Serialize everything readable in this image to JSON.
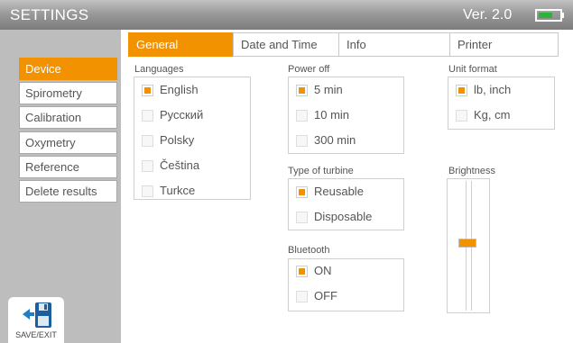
{
  "header": {
    "title": "SETTINGS",
    "version": "Ver. 2.0",
    "battery_level": 0.7,
    "battery_color": "#2bb33a"
  },
  "accent_color": "#f39200",
  "sidebar": {
    "items": [
      {
        "label": "Device",
        "active": true
      },
      {
        "label": "Spirometry",
        "active": false
      },
      {
        "label": "Calibration",
        "active": false
      },
      {
        "label": "Oxymetry",
        "active": false
      },
      {
        "label": "Reference",
        "active": false
      },
      {
        "label": "Delete results",
        "active": false
      }
    ]
  },
  "save_button": {
    "label": "SAVE/EXIT",
    "icon": "save-exit-icon"
  },
  "tabs": [
    {
      "label": "General",
      "active": true
    },
    {
      "label": "Date and Time",
      "active": false
    },
    {
      "label": "Info",
      "active": false
    },
    {
      "label": "Printer",
      "active": false
    }
  ],
  "languages": {
    "label": "Languages",
    "options": [
      {
        "label": "English",
        "checked": true
      },
      {
        "label": "Русский",
        "checked": false
      },
      {
        "label": "Polsky",
        "checked": false
      },
      {
        "label": "Čeština",
        "checked": false
      },
      {
        "label": "Turkce",
        "checked": false
      }
    ]
  },
  "power_off": {
    "label": "Power off",
    "options": [
      {
        "label": "5 min",
        "checked": true
      },
      {
        "label": "10 min",
        "checked": false
      },
      {
        "label": "300 min",
        "checked": false
      }
    ]
  },
  "turbine": {
    "label": "Type of turbine",
    "options": [
      {
        "label": "Reusable",
        "checked": true
      },
      {
        "label": "Disposable",
        "checked": false
      }
    ]
  },
  "bluetooth": {
    "label": "Bluetooth",
    "options": [
      {
        "label": "ON",
        "checked": true
      },
      {
        "label": "OFF",
        "checked": false
      }
    ]
  },
  "unit_format": {
    "label": "Unit format",
    "options": [
      {
        "label": "lb, inch",
        "checked": true
      },
      {
        "label": "Kg, cm",
        "checked": false
      }
    ]
  },
  "brightness": {
    "label": "Brightness",
    "level": 0.52
  }
}
